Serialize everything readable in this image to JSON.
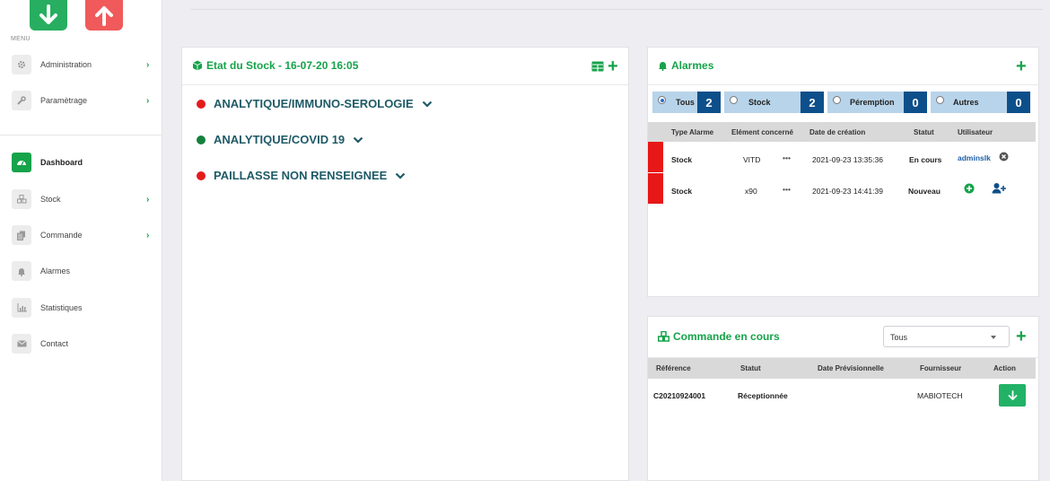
{
  "sidebar": {
    "menu_label": "MENU",
    "items": [
      {
        "label": "Administration",
        "icon": "gear-icon"
      },
      {
        "label": "Paramètrage",
        "icon": "wrench-icon"
      },
      {
        "label": "Dashboard",
        "icon": "dashboard-icon"
      },
      {
        "label": "Stock",
        "icon": "cubes-icon"
      },
      {
        "label": "Commande",
        "icon": "copy-icon"
      },
      {
        "label": "Alarmes",
        "icon": "bell-icon"
      },
      {
        "label": "Statistiques",
        "icon": "bar-chart-icon"
      },
      {
        "label": "Contact",
        "icon": "envelope-icon"
      }
    ]
  },
  "stock_panel": {
    "title": "Etat du Stock - 16-07-20 16:05",
    "rows": [
      {
        "label": "ANALYTIQUE/IMMUNO-SEROLOGIE",
        "status_color": "#e41b1b"
      },
      {
        "label": "ANALYTIQUE/COVID 19",
        "status_color": "#15803d"
      },
      {
        "label": "PAILLASSE NON RENSEIGNEE",
        "status_color": "#e41b1b"
      }
    ]
  },
  "alarms_panel": {
    "title": "Alarmes",
    "filters": [
      {
        "label": "Tous",
        "count": "2",
        "selected": true
      },
      {
        "label": "Stock",
        "count": "2",
        "selected": false
      },
      {
        "label": "Péremption",
        "count": "0",
        "selected": false
      },
      {
        "label": "Autres",
        "count": "0",
        "selected": false
      }
    ],
    "columns": [
      "Type Alarme",
      "Elément concerné",
      "Date de création",
      "Statut",
      "Utilisateur"
    ],
    "rows": [
      {
        "type": "Stock",
        "element": "VITD",
        "more": "•••",
        "date": "2021-09-23 13:35:36",
        "status": "En cours",
        "user": "adminslk"
      },
      {
        "type": "Stock",
        "element": "x90",
        "more": "•••",
        "date": "2021-09-23 14:41:39",
        "status": "Nouveau",
        "user": ""
      }
    ]
  },
  "orders_panel": {
    "title": "Commande en cours",
    "select_value": "Tous",
    "columns": [
      "Référence",
      "Statut",
      "Date Prévisionnelle",
      "Fournisseur",
      "Action"
    ],
    "rows": [
      {
        "reference": "C20210924001",
        "status": "Réceptionnée",
        "date": "",
        "supplier": "MABIOTECH"
      }
    ]
  },
  "colors": {
    "accent_green": "#16a34a",
    "alarm_red": "#e81818",
    "count_blue": "#0d4f8a",
    "filter_blue": "#b8d4ea"
  }
}
